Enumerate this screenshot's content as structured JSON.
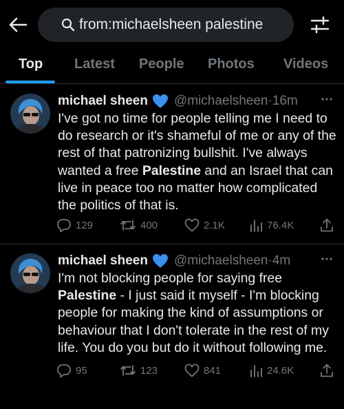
{
  "search": {
    "query": "from:michaelsheen palestine"
  },
  "tabs": [
    {
      "label": "Top"
    },
    {
      "label": "Latest"
    },
    {
      "label": "People"
    },
    {
      "label": "Photos"
    },
    {
      "label": "Videos"
    }
  ],
  "tweets": [
    {
      "name": "michael sheen",
      "handle": "@michaelsheen",
      "sep": "·",
      "time": "16m",
      "text_before": "I've got no time for people telling me I need to do research or it's shameful of me or any of the rest of that patronizing bullshit. I've always wanted a free ",
      "text_bold": "Palestine",
      "text_after": " and an Israel that can live in peace too no matter how complicated the politics of that is.",
      "replies": "129",
      "reposts": "400",
      "likes": "2.1K",
      "views": "76.4K"
    },
    {
      "name": "michael sheen",
      "handle": "@michaelsheen",
      "sep": "·",
      "time": "4m",
      "text_before": "I'm not blocking people for saying free ",
      "text_bold": "Palestine",
      "text_after": " - I just said it myself - I'm blocking people for making the kind of assumptions or behaviour that I don't tolerate in the rest of my life. You do you but do it without following me.",
      "replies": "95",
      "reposts": "123",
      "likes": "841",
      "views": "24.6K"
    }
  ],
  "colors": {
    "accent": "#1d9bf0",
    "muted": "#71767b",
    "text": "#e7e9ea",
    "background": "#000000"
  }
}
